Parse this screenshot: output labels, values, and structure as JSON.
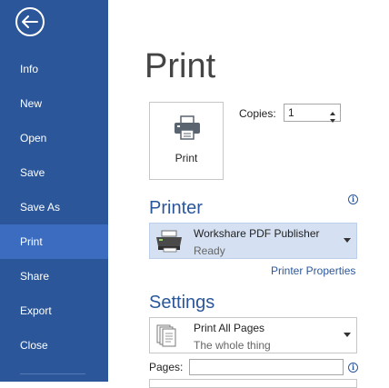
{
  "sidebar": {
    "back_icon": "back-arrow-icon",
    "items": [
      {
        "label": "Info"
      },
      {
        "label": "New"
      },
      {
        "label": "Open"
      },
      {
        "label": "Save"
      },
      {
        "label": "Save As"
      },
      {
        "label": "Print",
        "active": true
      },
      {
        "label": "Share"
      },
      {
        "label": "Export"
      },
      {
        "label": "Close"
      }
    ],
    "color": "#2b579a",
    "active_color": "#3c6cbf"
  },
  "main": {
    "title": "Print",
    "print_button": {
      "label": "Print",
      "icon": "printer-icon"
    },
    "copies": {
      "label": "Copies:",
      "value": "1"
    },
    "printer": {
      "heading": "Printer",
      "name": "Workshare PDF Publisher",
      "status": "Ready",
      "icon": "printer-device-icon",
      "properties_link": "Printer Properties"
    },
    "settings": {
      "heading": "Settings",
      "selection": "Print All Pages",
      "description": "The whole thing",
      "icon": "pages-icon",
      "pages_label": "Pages:",
      "pages_value": ""
    },
    "accent_color": "#2b579a"
  }
}
